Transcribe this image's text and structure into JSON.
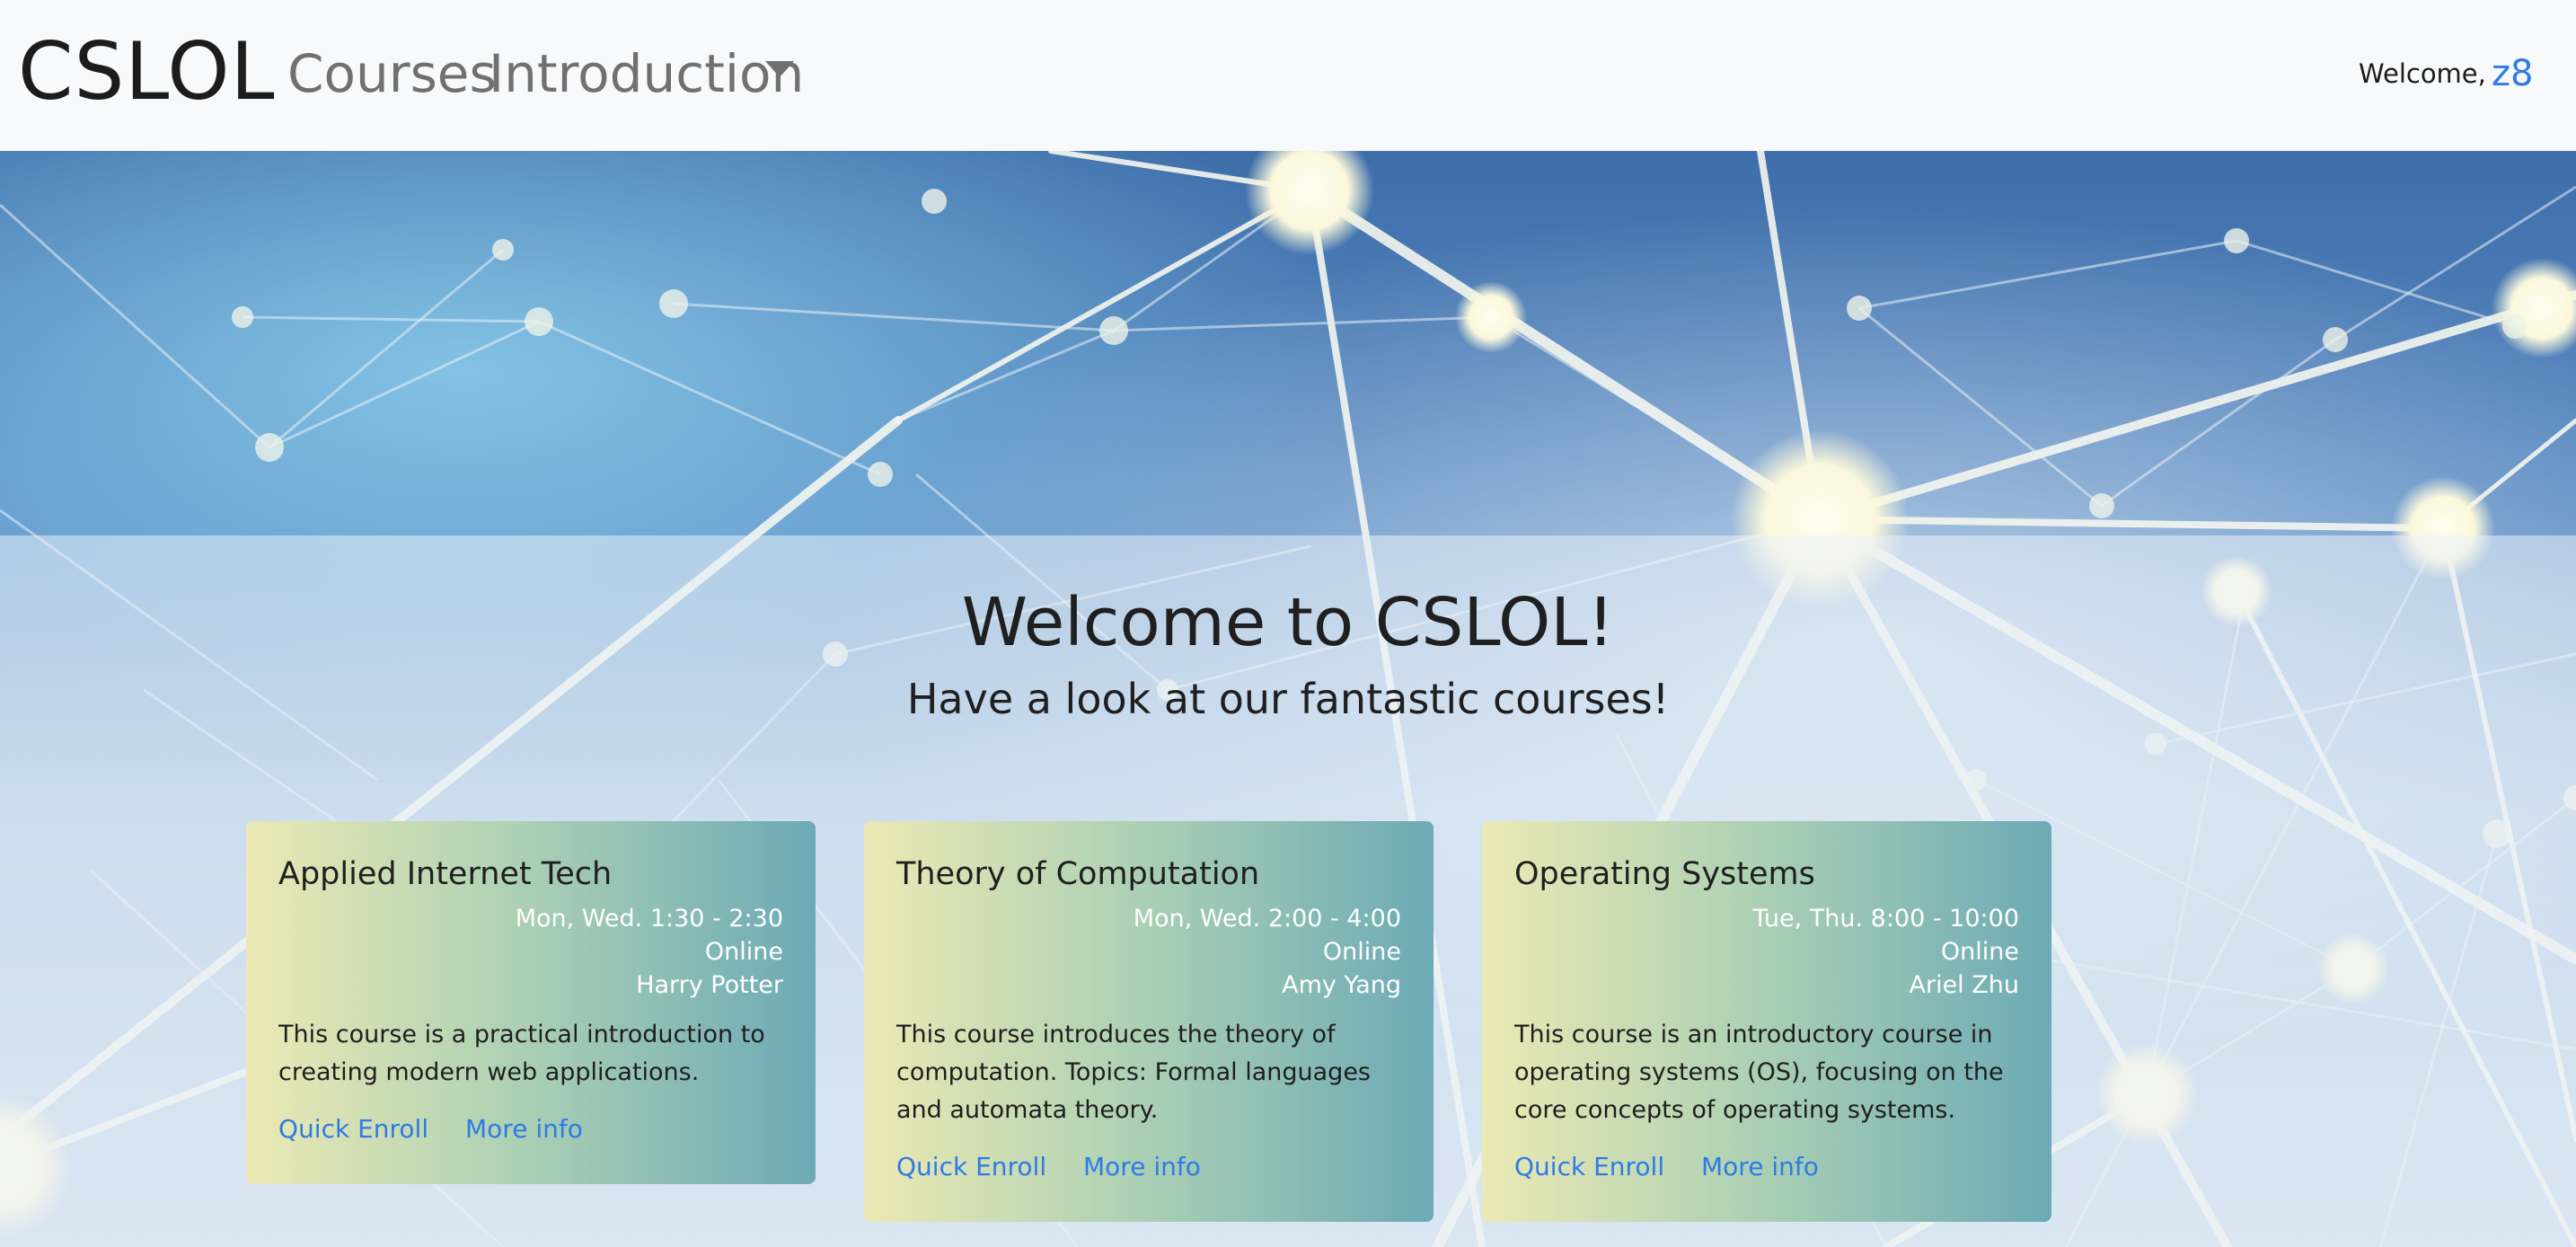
{
  "navbar": {
    "brand": "CSLOL",
    "links": [
      {
        "label": "Courses"
      },
      {
        "label": "Introduction"
      }
    ],
    "welcome": "Welcome,",
    "username": "z8"
  },
  "hero": {
    "title": "Welcome to CSLOL!",
    "subtitle": "Have a look at our fantastic courses!"
  },
  "courses": [
    {
      "title": "Applied Internet Tech",
      "schedule": "Mon, Wed. 1:30 - 2:30",
      "location": "Online",
      "instructor": "Harry Potter",
      "description": "This course is a practical introduction to creating modern web applications.",
      "enroll_label": "Quick Enroll",
      "info_label": "More info"
    },
    {
      "title": "Theory of Computation",
      "schedule": "Mon, Wed. 2:00 - 4:00",
      "location": "Online",
      "instructor": "Amy Yang",
      "description": "This course introduces the theory of computation. Topics: Formal languages and automata theory.",
      "enroll_label": "Quick Enroll",
      "info_label": "More info"
    },
    {
      "title": "Operating Systems",
      "schedule": "Tue, Thu. 8:00 - 10:00",
      "location": "Online",
      "instructor": "Ariel Zhu",
      "description": "This course is an introductory course in operating systems (OS), focusing on the core concepts of operating systems.",
      "enroll_label": "Quick Enroll",
      "info_label": "More info"
    }
  ],
  "colors": {
    "brand_text": "#1c1c1c",
    "nav_link": "#707070",
    "link_blue": "#2d7be6",
    "navbar_bg": "#f8f9fa",
    "network_dark": "#2f5f9c",
    "card_gradient_start": "#ece9b4",
    "card_gradient_end": "#6caab6"
  }
}
